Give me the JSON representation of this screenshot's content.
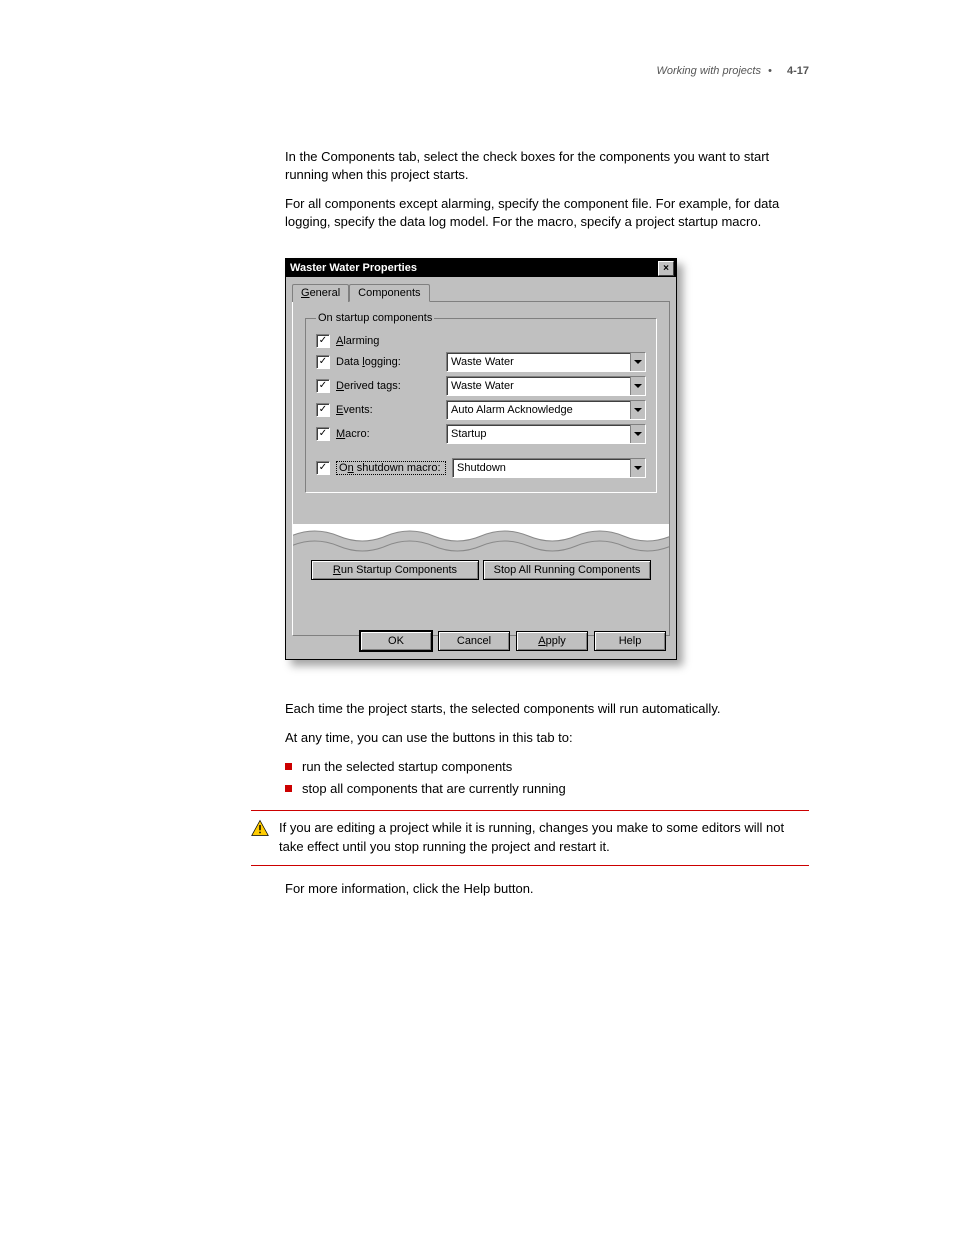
{
  "header": {
    "chapter": "Working with projects",
    "page_label": "4-17"
  },
  "intro": {
    "p1": "In the Components tab, select the check boxes for the components you want to start running when this project starts.",
    "p2": "For all components except alarming, specify the component file. For example, for data logging, specify the data log model. For the macro, specify a project startup macro."
  },
  "dialog": {
    "title": "Waster Water Properties",
    "tabs": {
      "general": "General",
      "components": "Components"
    },
    "group_legend": "On startup components",
    "rows": {
      "alarming": "Alarming",
      "datalogging_label": "Data logging:",
      "datalogging_value": "Waste Water",
      "derived_label": "Derived tags:",
      "derived_value": "Waste Water",
      "events_label": "Events:",
      "events_value": "Auto Alarm Acknowledge",
      "macro_label": "Macro:",
      "macro_value": "Startup",
      "shutdown_label": "On shutdown macro:",
      "shutdown_value": "Shutdown"
    },
    "buttons": {
      "run_startup": "Run Startup Components",
      "stop_all": "Stop All Running Components",
      "ok": "OK",
      "cancel": "Cancel",
      "apply": "Apply",
      "help": "Help"
    }
  },
  "body": {
    "p3": "Each time the project starts, the selected components will run automatically.",
    "p4": "At any time, you can use the buttons in this tab to:",
    "b1": "run the selected startup components",
    "b2": "stop all components that are currently running",
    "warn": "If you are editing a project while it is running, changes you make to some editors will not take effect until you stop running the project and restart it.",
    "p5": "For more information, click the Help button."
  }
}
